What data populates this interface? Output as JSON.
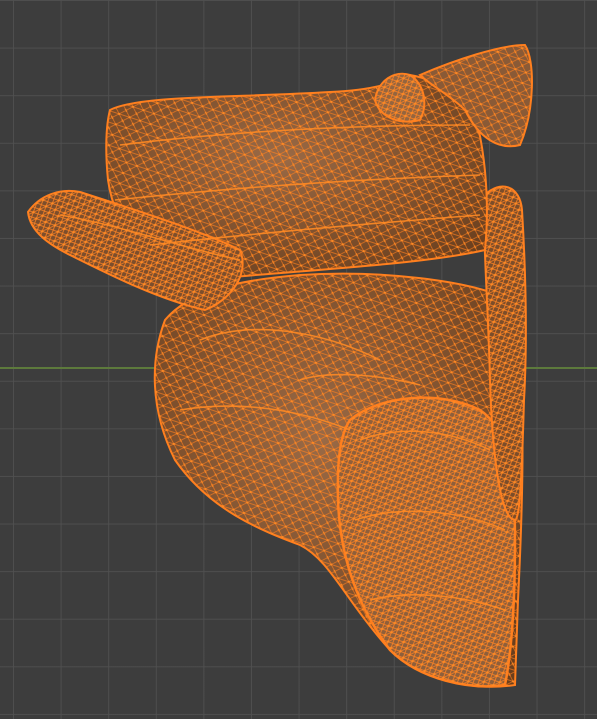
{
  "viewport": {
    "mode": "edit-mode-wireframe",
    "selection": "all",
    "colors": {
      "background": "#3d3d3d",
      "grid": "#4f4f4f",
      "x_axis": "#5d7a3c",
      "mesh_fill": "#8a5a36",
      "mesh_edge": "#ff7f1e",
      "vertex": "#ff8a24"
    }
  }
}
